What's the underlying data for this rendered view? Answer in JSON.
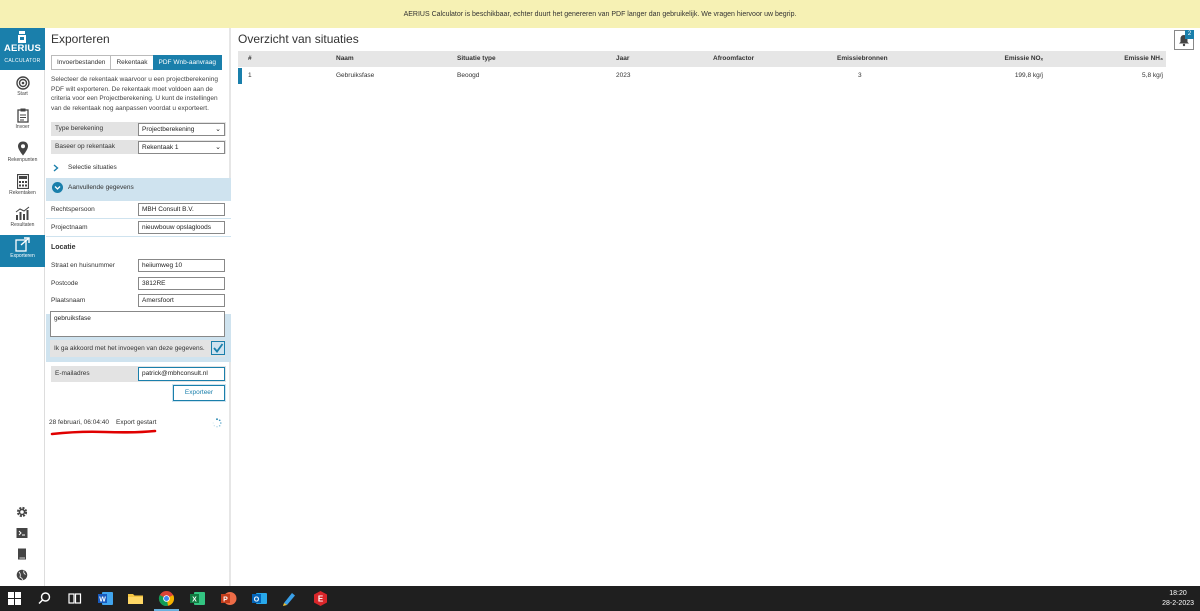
{
  "banner": {
    "text": "AERIUS Calculator is beschikbaar, echter duurt het genereren van PDF langer dan gebruikelijk. We vragen hiervoor uw begrip."
  },
  "logo": {
    "brand": "AERIUS",
    "product": "CALCULATOR"
  },
  "nav": {
    "items": [
      {
        "label": "Start",
        "icon": "target-icon"
      },
      {
        "label": "Invoer",
        "icon": "clipboard-icon"
      },
      {
        "label": "Rekenpunten",
        "icon": "map-pin-icon"
      },
      {
        "label": "Rekentaken",
        "icon": "calculator-icon"
      },
      {
        "label": "Resultaten",
        "icon": "bar-chart-icon"
      },
      {
        "label": "Exporteren",
        "icon": "export-icon"
      }
    ],
    "bottom_icons": [
      "gear-icon",
      "terminal-icon",
      "book-icon",
      "globe-icon"
    ]
  },
  "export": {
    "title": "Exporteren",
    "tabs": [
      "Invoerbestanden",
      "Rekentaak",
      "PDF Wnb-aanvraag"
    ],
    "intro": "Selecteer de rekentaak waarvoor u een projectberekening PDF wilt exporteren. De rekentaak moet voldoen aan de criteria voor een Projectberekening. U kunt de instellingen van de rekentaak nog aanpassen voordat u exporteert.",
    "type_label": "Type berekening",
    "type_value": "Projectberekening",
    "base_label": "Baseer op rekentaak",
    "base_value": "Rekentaak 1",
    "selection_label": "Selectie situaties",
    "extra_label": "Aanvullende gegevens",
    "legal_label": "Rechtspersoon",
    "legal_value": "MBH Consult B.V.",
    "project_label": "Projectnaam",
    "project_value": "nieuwbouw opslagloods",
    "location_heading": "Locatie",
    "street_label": "Straat en huisnummer",
    "street_value": "heiiumweg 10",
    "postcode_label": "Postcode",
    "postcode_value": "3812RE",
    "city_label": "Plaatsnaam",
    "city_value": "Amersfoort",
    "description_value": "gebruiksfase",
    "agree_label": "Ik ga akkoord met het invoegen van deze gegevens.",
    "email_label": "E-mailadres",
    "email_value": "patrick@mbhconsult.nl",
    "button_label": "Exporteer",
    "status_timestamp": "28 februari, 06:04:40",
    "status_message": "Export gestart"
  },
  "overview": {
    "title": "Overzicht van situaties",
    "notification_count": "2",
    "headers": [
      "#",
      "Naam",
      "Situatie type",
      "Jaar",
      "Afroomfactor",
      "Emissiebronnen",
      "Emissie NOₓ",
      "Emissie NH₃"
    ],
    "rows": [
      [
        "1",
        "Gebruiksfase",
        "Beoogd",
        "2023",
        "",
        "3",
        "199,8 kg/j",
        "5,8 kg/j"
      ]
    ]
  },
  "taskbar": {
    "time": "18:20",
    "date": "28-2-2023",
    "apps": [
      "windows-start-icon",
      "search-icon",
      "task-view-icon",
      "word-icon",
      "file-explorer-icon",
      "chrome-icon",
      "excel-icon",
      "powerpoint-icon",
      "outlook-icon",
      "paint-icon",
      "red-app-icon"
    ]
  },
  "colors": {
    "accent": "#1a7fab",
    "banner": "#f6f1b4",
    "panel_blue": "#cfe3ef",
    "annotation": "#e00000"
  }
}
